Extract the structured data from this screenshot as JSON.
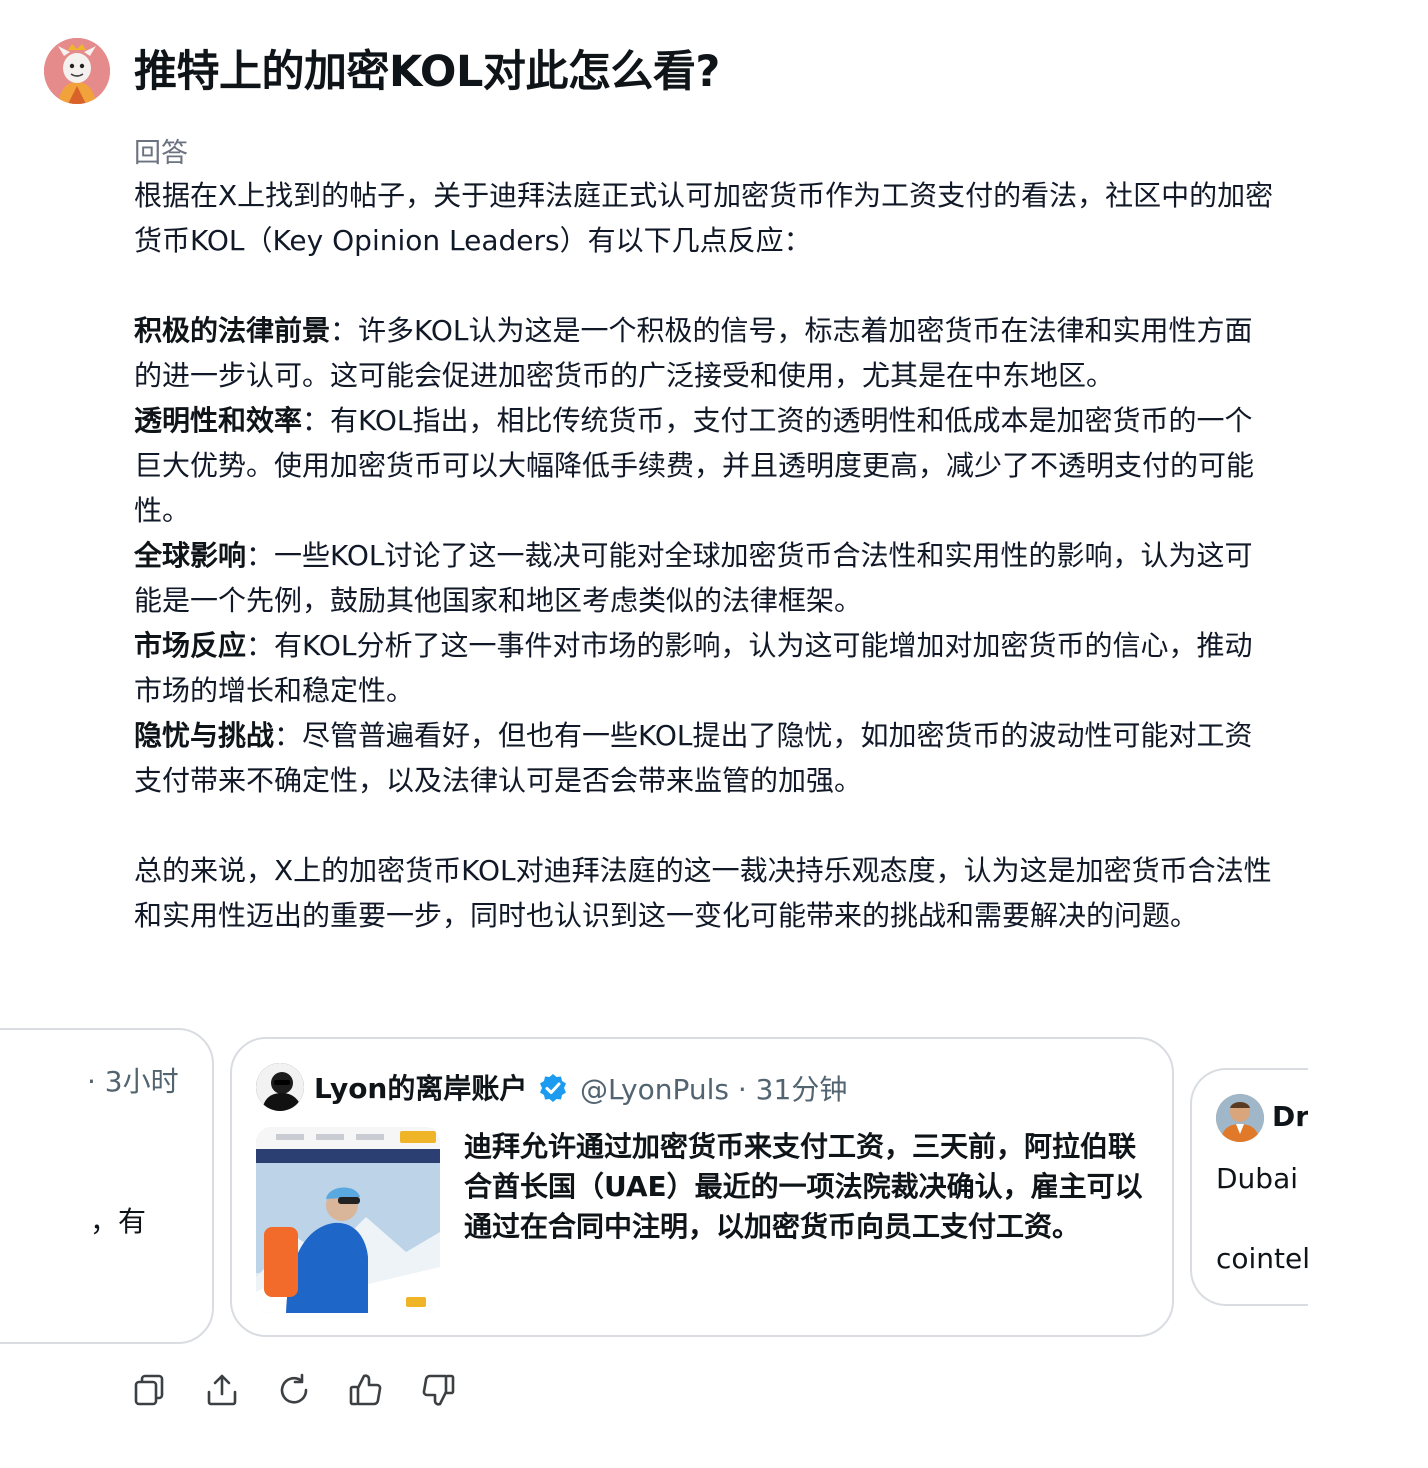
{
  "question": "推特上的加密KOL对此怎么看?",
  "answer_label": "回答",
  "intro": "根据在X上找到的帖子，关于迪拜法庭正式认可加密货币作为工资支付的看法，社区中的加密货币KOL（Key Opinion Leaders）有以下几点反应：",
  "points": [
    {
      "title": "积极的法律前景",
      "sep": "：",
      "text": "许多KOL认为这是一个积极的信号，标志着加密货币在法律和实用性方面的进一步认可。这可能会促进加密货币的广泛接受和使用，尤其是在中东地区。"
    },
    {
      "title": "透明性和效率",
      "sep": "：",
      "text": "有KOL指出，相比传统货币，支付工资的透明性和低成本是加密货币的一个巨大优势。使用加密货币可以大幅降低手续费，并且透明度更高，减少了不透明支付的可能性。"
    },
    {
      "title": "全球影响",
      "sep": "：",
      "text": "一些KOL讨论了这一裁决可能对全球加密货币合法性和实用性的影响，认为这可能是一个先例，鼓励其他国家和地区考虑类似的法律框架。"
    },
    {
      "title": "市场反应",
      "sep": "：",
      "text": "有KOL分析了这一事件对市场的影响，认为这可能增加对加密货币的信心，推动市场的增长和稳定性。"
    },
    {
      "title": "隐忧与挑战",
      "sep": "：",
      "text": "尽管普遍看好，但也有一些KOL提出了隐忧，如加密货币的波动性可能对工资支付带来不确定性，以及法律认可是否会带来监管的加强。"
    }
  ],
  "summary": "总的来说，X上的加密货币KOL对迪拜法庭的这一裁决持乐观态度，认为这是加密货币合法性和实用性迈出的重要一步，同时也认识到这一变化可能带来的挑战和需要解决的问题。",
  "cards": {
    "left": {
      "time": "· 3小时",
      "text": "，有"
    },
    "main": {
      "author": "Lyon的离岸账户",
      "handle_time": "@LyonPuls · 31分钟",
      "text": "迪拜允许通过加密货币来支付工资，三天前，阿拉伯联合酋长国（UAE）最近的一项法院裁决确认，雇主可以通过在合同中注明，以加密货币向员工支付工资。"
    },
    "right": {
      "name": "Dr",
      "line1": "Dubai",
      "line2": "cointel"
    }
  },
  "icons": {
    "verified": "verified-badge-icon",
    "actions": [
      "copy-icon",
      "share-icon",
      "regenerate-icon",
      "thumbs-up-icon",
      "thumbs-down-icon"
    ]
  },
  "colors": {
    "verified": "#1d9bf0",
    "text": "#0f1419",
    "muted": "#536471",
    "border": "#d9dde1"
  }
}
